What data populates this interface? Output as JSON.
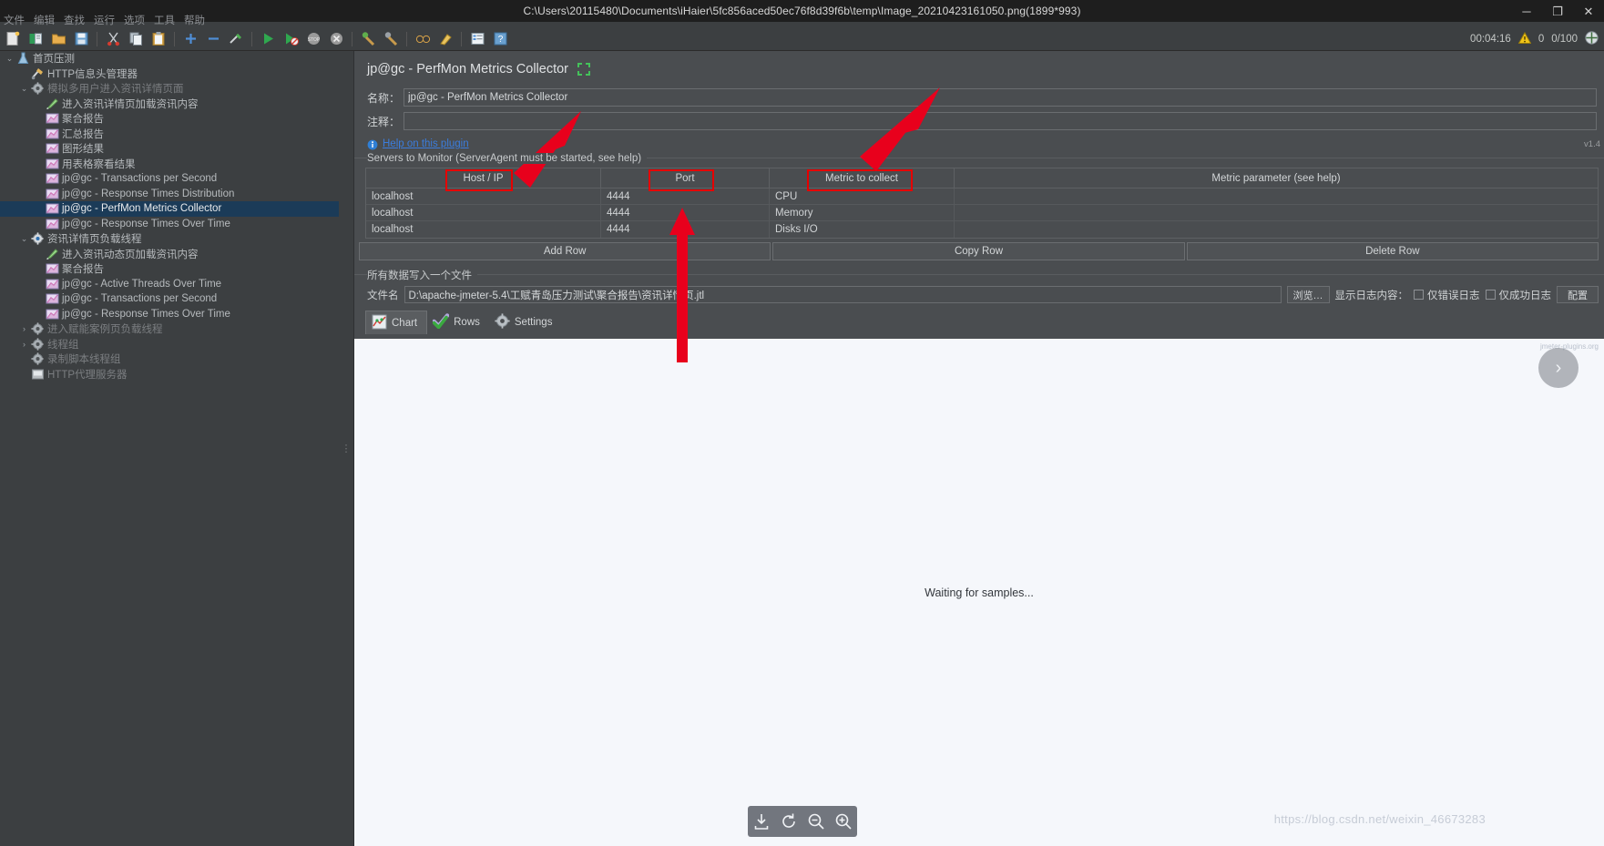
{
  "window": {
    "title": "C:\\Users\\20115480\\Documents\\iHaier\\5fc856aced50ec76f8d39f6b\\temp\\Image_20210423161050.png(1899*993)",
    "minimize": "─",
    "maximize": "❐",
    "close": "✕"
  },
  "menubar": {
    "items": [
      {
        "label": "文件"
      },
      {
        "label": "编辑"
      },
      {
        "label": "查找"
      },
      {
        "label": "运行"
      },
      {
        "label": "选项"
      },
      {
        "label": "工具"
      },
      {
        "label": "帮助"
      }
    ]
  },
  "toolbar": {
    "status": {
      "elapsed": "00:04:16",
      "warnings": "0",
      "threads": "0/100"
    }
  },
  "tree": {
    "items": [
      {
        "label": "首页压测",
        "depth": 0,
        "twist": "⌄",
        "icon": "test-plan-icon",
        "state": "normal"
      },
      {
        "label": "HTTP信息头管理器",
        "depth": 1,
        "twist": "",
        "icon": "header-manager-icon",
        "state": "normal"
      },
      {
        "label": "模拟多用户进入资讯详情页面",
        "depth": 1,
        "twist": "⌄",
        "icon": "thread-group-icon",
        "state": "disabled"
      },
      {
        "label": "进入资讯详情页加载资讯内容",
        "depth": 2,
        "twist": "",
        "icon": "sampler-icon",
        "state": "normal"
      },
      {
        "label": "聚合报告",
        "depth": 2,
        "twist": "",
        "icon": "listener-icon",
        "state": "normal"
      },
      {
        "label": "汇总报告",
        "depth": 2,
        "twist": "",
        "icon": "listener-icon",
        "state": "normal"
      },
      {
        "label": "图形结果",
        "depth": 2,
        "twist": "",
        "icon": "listener-icon",
        "state": "normal"
      },
      {
        "label": "用表格察看结果",
        "depth": 2,
        "twist": "",
        "icon": "listener-icon",
        "state": "normal"
      },
      {
        "label": "jp@gc - Transactions per Second",
        "depth": 2,
        "twist": "",
        "icon": "listener-icon",
        "state": "normal"
      },
      {
        "label": "jp@gc - Response Times Distribution",
        "depth": 2,
        "twist": "",
        "icon": "listener-icon",
        "state": "normal"
      },
      {
        "label": "jp@gc - PerfMon Metrics Collector",
        "depth": 2,
        "twist": "",
        "icon": "listener-icon",
        "state": "selected"
      },
      {
        "label": "jp@gc - Response Times Over Time",
        "depth": 2,
        "twist": "",
        "icon": "listener-icon",
        "state": "normal"
      },
      {
        "label": "资讯详情页负载线程",
        "depth": 1,
        "twist": "⌄",
        "icon": "thread-group-active-icon",
        "state": "normal"
      },
      {
        "label": "进入资讯动态页加载资讯内容",
        "depth": 2,
        "twist": "",
        "icon": "sampler-icon",
        "state": "normal"
      },
      {
        "label": "聚合报告",
        "depth": 2,
        "twist": "",
        "icon": "listener-icon",
        "state": "normal"
      },
      {
        "label": "jp@gc - Active Threads Over Time",
        "depth": 2,
        "twist": "",
        "icon": "listener-icon",
        "state": "normal"
      },
      {
        "label": "jp@gc - Transactions per Second",
        "depth": 2,
        "twist": "",
        "icon": "listener-icon",
        "state": "normal"
      },
      {
        "label": "jp@gc - Response Times Over Time",
        "depth": 2,
        "twist": "",
        "icon": "listener-icon",
        "state": "normal"
      },
      {
        "label": "进入赋能案例页负载线程",
        "depth": 1,
        "twist": "›",
        "icon": "thread-group-icon",
        "state": "disabled"
      },
      {
        "label": "线程组",
        "depth": 1,
        "twist": "›",
        "icon": "thread-group-icon",
        "state": "disabled"
      },
      {
        "label": "录制脚本线程组",
        "depth": 1,
        "twist": "",
        "icon": "thread-group-icon",
        "state": "disabled"
      },
      {
        "label": "HTTP代理服务器",
        "depth": 1,
        "twist": "",
        "icon": "proxy-server-icon",
        "state": "disabled"
      }
    ]
  },
  "panel": {
    "title": "jp@gc - PerfMon Metrics Collector",
    "name_label": "名称：",
    "name_value": "jp@gc - PerfMon Metrics Collector",
    "comment_label": "注释：",
    "comment_value": "",
    "help_link": "Help on this plugin",
    "version": "v1.4",
    "group_title": "Servers to Monitor (ServerAgent must be started, see help)",
    "table": {
      "columns": [
        "Host / IP",
        "Port",
        "Metric to collect",
        "Metric parameter (see help)"
      ],
      "rows": [
        [
          "localhost",
          "4444",
          "CPU",
          ""
        ],
        [
          "localhost",
          "4444",
          "Memory",
          ""
        ],
        [
          "localhost",
          "4444",
          "Disks I/O",
          ""
        ]
      ]
    },
    "buttons": {
      "add_row": "Add Row",
      "copy_row": "Copy Row",
      "delete_row": "Delete Row"
    },
    "file_group_title": "所有数据写入一个文件",
    "file_label": "文件名",
    "file_value": "D:\\apache-jmeter-5.4\\工赋青岛压力测试\\聚合报告\\资讯详情页.jtl",
    "browse_button": "浏览…",
    "log_label": "显示日志内容：",
    "error_only": "仅错误日志",
    "success_only": "仅成功日志",
    "config_button": "配置",
    "tabs": [
      {
        "label": "Chart",
        "icon": "chart-icon",
        "active": true
      },
      {
        "label": "Rows",
        "icon": "check-icon",
        "active": false
      },
      {
        "label": "Settings",
        "icon": "gear-icon",
        "active": false
      }
    ],
    "chart_placeholder": "Waiting for samples...",
    "chart_watermark": "jmeter-plugins.org"
  },
  "viewer": {
    "next_arrow": "›",
    "watermark": "https://blog.csdn.net/weixin_46673283",
    "bottom_tools": [
      {
        "name": "download-icon"
      },
      {
        "name": "rotate-icon"
      },
      {
        "name": "zoom-out-icon"
      },
      {
        "name": "zoom-in-icon"
      }
    ]
  },
  "colors": {
    "accent": "#3b7ddd",
    "annotation": "#e60000",
    "selection": "#1b3b58",
    "panel_bg": "#4a4d50",
    "chart_bg": "#f5f7fb"
  }
}
